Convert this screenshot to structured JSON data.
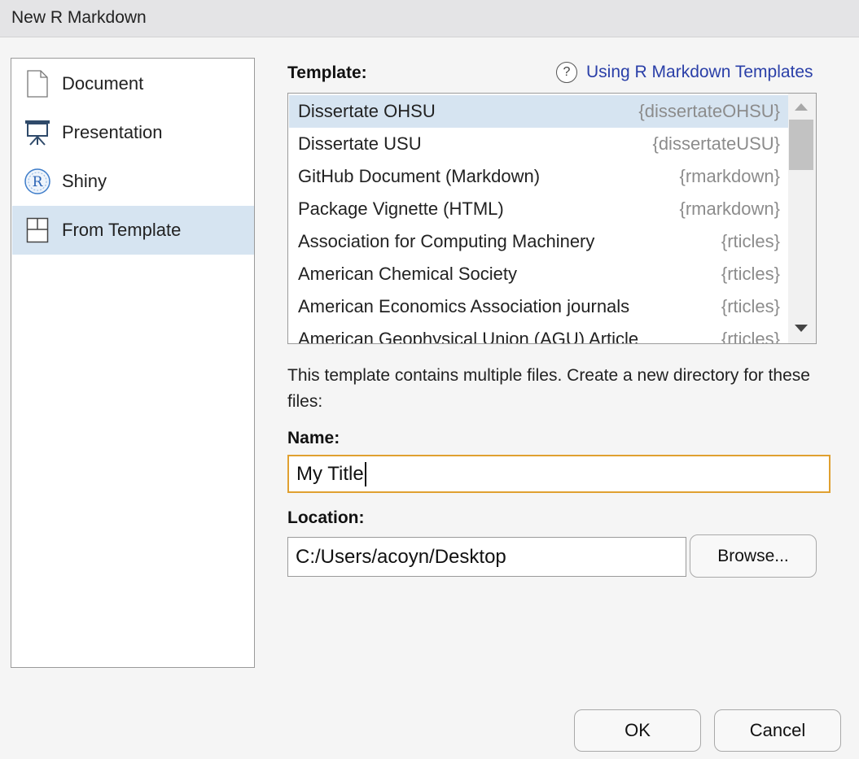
{
  "window": {
    "title": "New R Markdown"
  },
  "sidebar": {
    "items": [
      {
        "label": "Document",
        "icon": "document-icon"
      },
      {
        "label": "Presentation",
        "icon": "presentation-icon"
      },
      {
        "label": "Shiny",
        "icon": "shiny-icon"
      },
      {
        "label": "From Template",
        "icon": "template-icon",
        "selected": true
      }
    ]
  },
  "template": {
    "label": "Template:",
    "help_link": "Using R Markdown Templates",
    "help_icon_glyph": "?",
    "rows": [
      {
        "name": "Dissertate OHSU",
        "package": "{dissertateOHSU}",
        "selected": true
      },
      {
        "name": "Dissertate USU",
        "package": "{dissertateUSU}"
      },
      {
        "name": "GitHub Document (Markdown)",
        "package": "{rmarkdown}"
      },
      {
        "name": "Package Vignette (HTML)",
        "package": "{rmarkdown}"
      },
      {
        "name": "Association for Computing Machinery",
        "package": "{rticles}"
      },
      {
        "name": "American Chemical Society",
        "package": "{rticles}"
      },
      {
        "name": "American Economics Association journals",
        "package": "{rticles}"
      },
      {
        "name": "American Geophysical Union (AGU) Article",
        "package": "{rticles}"
      }
    ]
  },
  "description": "This template contains multiple files. Create a new directory for these files:",
  "name_field": {
    "label": "Name:",
    "value": "My Title"
  },
  "location_field": {
    "label": "Location:",
    "value": "C:/Users/acoyn/Desktop",
    "browse_label": "Browse..."
  },
  "buttons": {
    "ok": "OK",
    "cancel": "Cancel"
  },
  "colors": {
    "selection": "#d6e4f1",
    "focus_border": "#e0a030",
    "link": "#2a3fa8"
  }
}
